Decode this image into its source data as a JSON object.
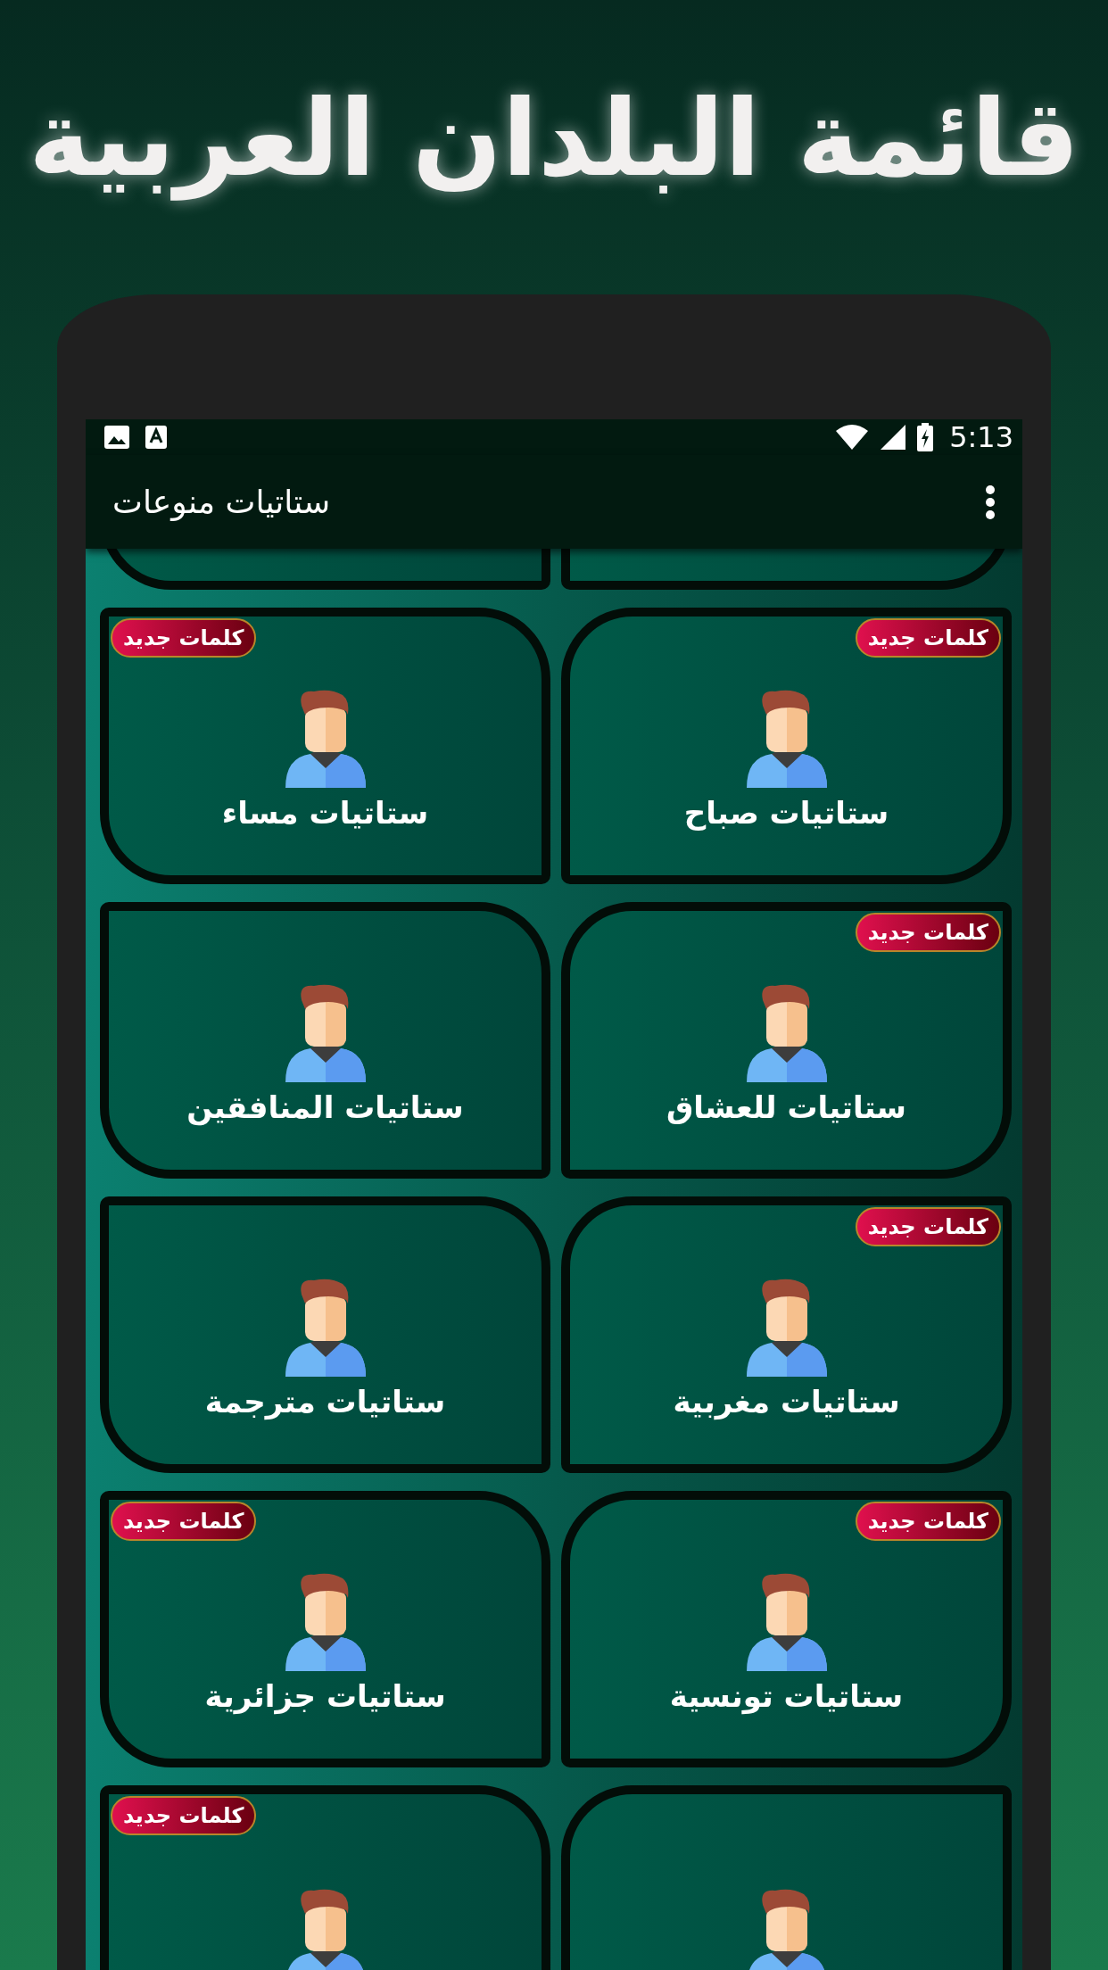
{
  "headline": "قائمة البلدان العربية",
  "status_bar": {
    "time": "5:13"
  },
  "toolbar": {
    "title": "ستاتيات منوعات"
  },
  "cards": [
    {
      "kind": "stub"
    },
    {
      "kind": "stub"
    },
    {
      "kind": "tile",
      "label": "ستاتيات صباح",
      "badge": "كلمات جديد"
    },
    {
      "kind": "tile",
      "label": "ستاتيات مساء",
      "badge": "كلمات جديد"
    },
    {
      "kind": "tile",
      "label": "ستاتيات للعشاق",
      "badge": "كلمات جديد"
    },
    {
      "kind": "tile",
      "label": "ستاتيات المنافقين"
    },
    {
      "kind": "tile",
      "label": "ستاتيات مغربية",
      "badge": "كلمات جديد"
    },
    {
      "kind": "tile",
      "label": "ستاتيات مترجمة"
    },
    {
      "kind": "tile",
      "label": "ستاتيات تونسية",
      "badge": "كلمات جديد"
    },
    {
      "kind": "tile",
      "label": "ستاتيات جزائرية",
      "badge": "كلمات جديد"
    },
    {
      "kind": "tile"
    },
    {
      "kind": "tile",
      "badge": "كلمات جديد"
    }
  ]
}
